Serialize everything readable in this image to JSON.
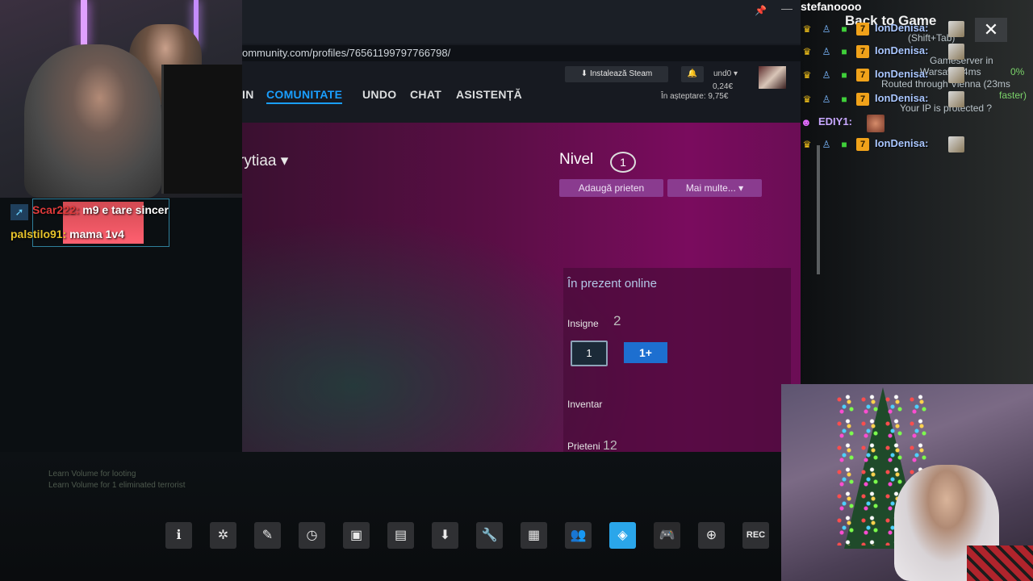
{
  "browser": {
    "url": "ommunity.com/profiles/76561199797766798/",
    "nav": [
      "IN",
      "COMUNITATE",
      "UNDO",
      "CHAT",
      "ASISTENȚĂ"
    ],
    "active_nav": "COMUNITATE",
    "install_label": "Instalează Steam",
    "account_name": "und0",
    "balance": "0,24€",
    "pending": "În așteptare: 9,75€"
  },
  "profile": {
    "name": "rytiaa",
    "level_label": "Nivel",
    "level": "1",
    "add_friend": "Adaugă prieten",
    "more": "Mai multe...",
    "online_status": "În prezent online",
    "badges_label": "Insigne",
    "badges_count": "2",
    "badge1": "1",
    "badge2": "1+",
    "inventory_label": "Inventar",
    "friends_label": "Prieteni",
    "friends_count": "12"
  },
  "left_chat": [
    {
      "user": "Scar222:",
      "message": "m9 e tare sincer",
      "color": "#e03a3a"
    },
    {
      "user": "palstilo91:",
      "message": "mama 1v4",
      "color": "#e6c22a"
    }
  ],
  "killfeed": [
    "Learn Volume for looting",
    "Learn Volume for 1 eliminated terrorist"
  ],
  "toolbar": {
    "buttons": [
      "info",
      "achievements",
      "edit",
      "history",
      "guides",
      "chat",
      "downloads",
      "settings",
      "screenshots",
      "friends",
      "browser",
      "controller",
      "web",
      "REC"
    ],
    "active": "browser"
  },
  "right_overlay": {
    "streamer": "stefanoooo",
    "back_to_game": "Back to Game",
    "shortcut": "(Shift+Tab)",
    "vpn_lines": [
      "Gameserver in",
      "Warsaw 34ms",
      "0%",
      "Routed through Vienna (23ms",
      "faster)",
      "Your IP is protected"
    ],
    "chat": [
      {
        "user": "IonDenisa:"
      },
      {
        "user": "IonDenisa:"
      },
      {
        "user": "IonDenisa:"
      },
      {
        "user": "IonDenisa:"
      },
      {
        "user": "EDIY1:"
      },
      {
        "user": "IonDenisa:"
      }
    ]
  }
}
